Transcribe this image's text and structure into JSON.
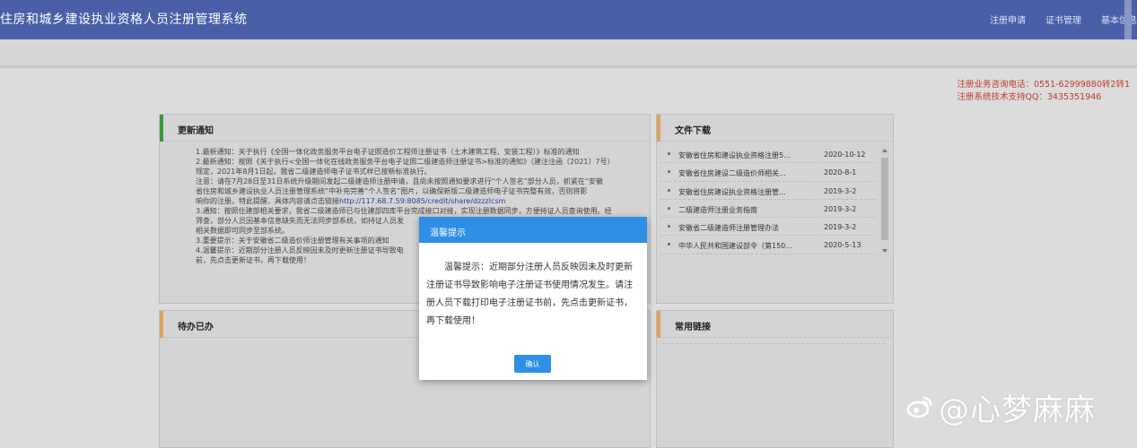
{
  "header": {
    "title": "住房和城乡建设执业资格人员注册管理系统",
    "nav": [
      "注册申请",
      "证书管理",
      "基本信息"
    ]
  },
  "contact": {
    "phone": "注册业务咨询电话：0551-62999880转2转1",
    "qq": "注册系统技术支持QQ：3435351946"
  },
  "panels": {
    "notice": {
      "title": "更新通知",
      "lines": [
        "1.最新通知：关于执行《全国一体化政务服务平台电子证照造价工程师注册证书（土木建筑工程、安装工程）》标准的通知",
        "2.最新通知：按照《关于执行<全国一体化在线政务服务平台电子证照二级建造师注册证书>标准的通知》（建注注函〔2021〕7号）",
        "规定，2021年8月1日起，我省二级建造师电子证书式样已按新标准执行。",
        "注意：请在7月28日至31日系统升级期间发起二级建造师注册申请，且尚未按照通知要求进行“个人签名”部分人员，抓紧在“安徽",
        "省住房和城乡建设执业人员注册管理系统”中补充完善“个人签名”图片，以确保新版二级建造师电子证书完整有效，否则将影",
        "响你的注册。特此提醒，具体内容请点击链接"
      ],
      "link": "http://117.68.7.59:8085/credit/share/dzzzlcsm",
      "lines2": [
        "3.通知：按照住建部相关要求，我省二级建造师已与住建部四库平台完成接口对接，实现注册数据同步，方便持证人员查询使用。经",
        "筛查，部分人员因基本信息缺失而无法同步部系统，如持证人员发",
        "相关数据即可同步至部系统。",
        "3.重要提示：关于安徽省二级造价师注册管理有关事项的通知",
        "4.温馨提示：近期部分注册人员反映因未及时更新注册证书导致电",
        "前，先点击更新证书，再下载使用！"
      ]
    },
    "downloads": {
      "title": "文件下载",
      "items": [
        {
          "name": "安徽省住房和建设执业资格注册5...",
          "date": "2020-10-12"
        },
        {
          "name": "安徽省住房建设二级造价师相关...",
          "date": "2020-8-1"
        },
        {
          "name": "安徽省住房建设执业资格注册管...",
          "date": "2019-3-2"
        },
        {
          "name": "二级建造师注册业务指南",
          "date": "2019-3-2"
        },
        {
          "name": "安徽省二级建造师注册管理办法",
          "date": "2019-3-2"
        },
        {
          "name": "中华人民共和国建设部令（第150...",
          "date": "2020-5-13"
        }
      ]
    },
    "todo": {
      "title": "待办已办"
    },
    "links": {
      "title": "常用链接"
    }
  },
  "modal": {
    "title": "温馨提示",
    "body": "温馨提示：近期部分注册人员反映因未及时更新注册证书导致影响电子注册证书使用情况发生。请注册人员下载打印电子注册证书前，先点击更新证书，再下载使用！",
    "ok_label": "确认"
  },
  "watermark": {
    "text": "@心梦麻麻"
  },
  "colors": {
    "header_bg": "#4a5fa8",
    "accent_green": "#3a9a3a",
    "accent_orange": "#e0a060",
    "modal_blue": "#2f8ee6",
    "contact_red": "#c0392b"
  }
}
